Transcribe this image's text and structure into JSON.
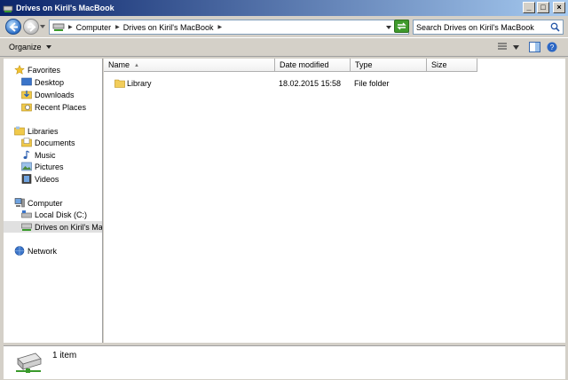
{
  "window": {
    "title": "Drives on Kiril's MacBook",
    "minimize": "_",
    "maximize": "□",
    "close": "×"
  },
  "address": {
    "crumbs": [
      "Computer",
      "Drives on Kiril's MacBook"
    ],
    "search_placeholder": "Search Drives on Kiril's MacBook"
  },
  "toolbar": {
    "organize": "Organize"
  },
  "nav": {
    "favorites": "Favorites",
    "desktop": "Desktop",
    "downloads": "Downloads",
    "recent_places": "Recent Places",
    "libraries": "Libraries",
    "documents": "Documents",
    "music": "Music",
    "pictures": "Pictures",
    "videos": "Videos",
    "computer": "Computer",
    "local_disk": "Local Disk (C:)",
    "drives_mac": "Drives on Kiril's MacBook",
    "network": "Network"
  },
  "columns": {
    "name": "Name",
    "date": "Date modified",
    "type": "Type",
    "size": "Size"
  },
  "files": [
    {
      "name": "Library",
      "date": "18.02.2015 15:58",
      "type": "File folder",
      "size": ""
    }
  ],
  "status": {
    "count": "1 item"
  },
  "colors": {
    "title_start": "#0a246a",
    "title_end": "#a6caf0",
    "face": "#d4d0c8"
  }
}
